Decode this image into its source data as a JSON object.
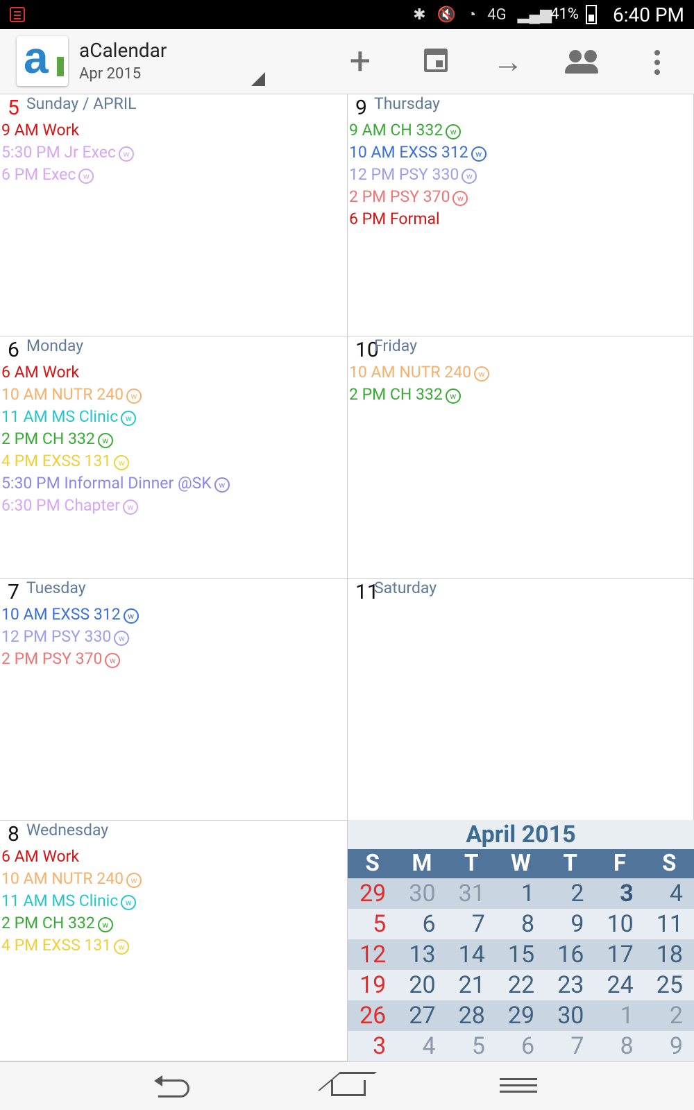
{
  "status": {
    "battery_percent": "41%",
    "time": "6:40 PM",
    "icons": [
      "calendar-notification-icon",
      "bluetooth-icon",
      "mute-icon",
      "wifi-icon",
      "4g-lte-icon",
      "signal-icon",
      "battery-icon"
    ]
  },
  "appbar": {
    "logo_text": "a",
    "title": "aCalendar",
    "subtitle": "Apr 2015",
    "actions": [
      "add-icon",
      "today-calendar-icon",
      "forward-arrow-icon",
      "people-icon",
      "more-options-icon"
    ]
  },
  "days": [
    {
      "num": "5",
      "name": "Sunday / APRIL",
      "events": [
        {
          "text": "9 AM Work",
          "color": "#d41414",
          "w": false
        },
        {
          "text": "5:30 PM Jr Exec",
          "color": "#d6a6f5",
          "w": true
        },
        {
          "text": "6 PM Exec",
          "color": "#d6a6f5",
          "w": true
        }
      ]
    },
    {
      "num": "9",
      "name": "Thursday",
      "events": [
        {
          "text": "9 AM CH 332",
          "color": "#39a935",
          "w": true
        },
        {
          "text": "10 AM EXSS 312",
          "color": "#3a6fdc",
          "w": true
        },
        {
          "text": "12 PM PSY 330",
          "color": "#9b9ef0",
          "w": true
        },
        {
          "text": "2 PM PSY 370",
          "color": "#f07474",
          "w": true
        },
        {
          "text": "6 PM Formal",
          "color": "#d41414",
          "w": false
        }
      ]
    },
    {
      "num": "6",
      "name": "Monday",
      "events": [
        {
          "text": "6 AM Work",
          "color": "#d41414",
          "w": false
        },
        {
          "text": "10 AM NUTR 240",
          "color": "#f5b06d",
          "w": true
        },
        {
          "text": "11 AM MS Clinic",
          "color": "#25c6c9",
          "w": true
        },
        {
          "text": "2 PM CH 332",
          "color": "#39a935",
          "w": true
        },
        {
          "text": "4 PM EXSS 131",
          "color": "#f1cf39",
          "w": true
        },
        {
          "text": "5:30 PM Informal Dinner @SK",
          "color": "#8b88e8",
          "w": true
        },
        {
          "text": "6:30 PM Chapter",
          "color": "#d6a6f5",
          "w": true
        }
      ]
    },
    {
      "num": "10",
      "name": "Friday",
      "events": [
        {
          "text": "10 AM NUTR 240",
          "color": "#f5b06d",
          "w": true
        },
        {
          "text": "2 PM CH 332",
          "color": "#39a935",
          "w": true
        }
      ]
    },
    {
      "num": "7",
      "name": "Tuesday",
      "events": [
        {
          "text": "10 AM EXSS 312",
          "color": "#3a6fdc",
          "w": true
        },
        {
          "text": "12 PM PSY 330",
          "color": "#9b9ef0",
          "w": true
        },
        {
          "text": "2 PM PSY 370",
          "color": "#f07474",
          "w": true
        }
      ]
    },
    {
      "num": "11",
      "name": "Saturday",
      "events": []
    },
    {
      "num": "8",
      "name": "Wednesday",
      "events": [
        {
          "text": "6 AM Work",
          "color": "#d41414",
          "w": false
        },
        {
          "text": "10 AM NUTR 240",
          "color": "#f5b06d",
          "w": true
        },
        {
          "text": "11 AM MS Clinic",
          "color": "#25c6c9",
          "w": true
        },
        {
          "text": "2 PM CH 332",
          "color": "#39a935",
          "w": true
        },
        {
          "text": "4 PM EXSS 131",
          "color": "#f1cf39",
          "w": true
        }
      ]
    }
  ],
  "event_badge": "w",
  "mini_calendar": {
    "title": "April 2015",
    "weekday_headers": [
      "S",
      "M",
      "T",
      "W",
      "T",
      "F",
      "S"
    ],
    "rows": [
      [
        "29",
        "30",
        "31",
        "1",
        "2",
        "3",
        "4"
      ],
      [
        "5",
        "6",
        "7",
        "8",
        "9",
        "10",
        "11"
      ],
      [
        "12",
        "13",
        "14",
        "15",
        "16",
        "17",
        "18"
      ],
      [
        "19",
        "20",
        "21",
        "22",
        "23",
        "24",
        "25"
      ],
      [
        "26",
        "27",
        "28",
        "29",
        "30",
        "1",
        "2"
      ],
      [
        "3",
        "4",
        "5",
        "6",
        "7",
        "8",
        "9"
      ]
    ],
    "today": "3",
    "colors": {
      "sunday": "#e12c2c",
      "header": "#50749a"
    }
  },
  "navigation": [
    "back-icon",
    "home-icon",
    "menu-icon"
  ]
}
